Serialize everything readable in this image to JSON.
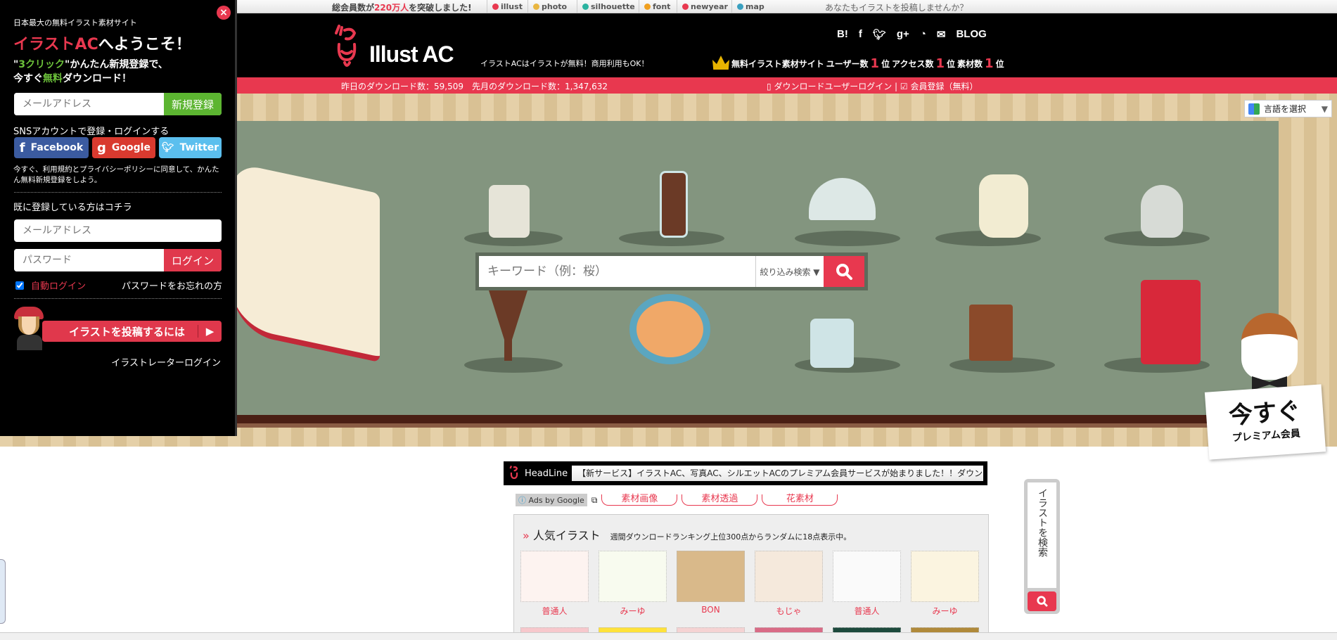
{
  "topbar": {
    "notice_prefix": "総会員数が",
    "notice_count": "220万人",
    "notice_suffix": "を突破しました!",
    "sites": [
      {
        "label": "illust",
        "color": "#e8384f"
      },
      {
        "label": "photo",
        "color": "#e9b640"
      },
      {
        "label": "silhouette",
        "color": "#2bb3a0"
      },
      {
        "label": "font",
        "color": "#f0a020"
      },
      {
        "label": "newyear",
        "color": "#e8384f"
      },
      {
        "label": "map",
        "color": "#3aa0c0"
      }
    ],
    "invite": "あなたもイラストを投稿しませんか？"
  },
  "header": {
    "logo": "Illust AC",
    "tagline": "イラストACはイラストが無料！商用利用もOK！",
    "social": [
      "B!",
      "f",
      "twitter-icon",
      "g+",
      "rss-icon",
      "mail-icon",
      "BLOG"
    ],
    "rank_prefix": "無料イラスト素材サイト",
    "ranks": [
      {
        "label": "ユーザー数",
        "value": "1",
        "unit": "位"
      },
      {
        "label": "アクセス数",
        "value": "1",
        "unit": "位"
      },
      {
        "label": "素材数",
        "value": "1",
        "unit": "位"
      }
    ]
  },
  "redbar": {
    "stats": "昨日のダウンロード数：59,509　先月のダウンロード数：1,347,632",
    "login_link": "ダウンロードユーザーログイン",
    "separator": "|",
    "register_link": "会員登録（無料）"
  },
  "banner": {
    "language_select": "言語を選択",
    "search_placeholder": "キーワード（例：桜）",
    "filter_label": "絞り込み検索 ▼",
    "sign_big": "今すぐ",
    "sign_small": "プレミアム会員"
  },
  "sidebar": {
    "subtitle": "日本最大の無料イラスト素材サイト",
    "welcome_red": "イラストAC",
    "welcome_rest": "へようこそ！",
    "line1_q1": "\"",
    "line1_green": "3クリック",
    "line1_rest": "\"かんたん新規登録で、",
    "line2_pre": "今すぐ",
    "line2_green": "無料",
    "line2_rest": "ダウンロード！",
    "email_placeholder": "メールアドレス",
    "register_button": "新規登録",
    "sns_label": "SNSアカウントで登録・ログインする",
    "facebook": "Facebook",
    "google": "Google",
    "twitter": "Twitter",
    "terms": "今すぐ、利用規約とプライバシーポリシーに同意して、かんたん無料新規登録をしよう。",
    "existing_label": "既に登録している方はコチラ",
    "login_email_placeholder": "メールアドレス",
    "password_placeholder": "パスワード",
    "login_button": "ログイン",
    "auto_login": "自動ログイン",
    "auto_login_checked": true,
    "forgot_password": "パスワードをお忘れの方",
    "post_button": "イラストを投稿するには",
    "illustrator_login": "イラストレーターログイン"
  },
  "headline": {
    "label": "HeadLine",
    "text": "【新サービス】イラストAC、写真AC、シルエットACのプレミアム会員サービスが始まりました！！ダウン"
  },
  "ads": {
    "label": "Ads by Google",
    "links": [
      "素材画像",
      "素材透過",
      "花素材"
    ]
  },
  "popular": {
    "title": "人気イラスト",
    "subtitle": "週間ダウンロードランキング上位300点からランダムに18点表示中。",
    "items": [
      {
        "author": "普通人"
      },
      {
        "author": "みーゆ"
      },
      {
        "author": "BON"
      },
      {
        "author": "もじゃ"
      },
      {
        "author": "普通人"
      },
      {
        "author": "みーゆ"
      }
    ]
  },
  "vertical_search": {
    "placeholder": "イラストを検索"
  },
  "colors": {
    "accent": "#e8384f",
    "green": "#5cb531",
    "board": "#83957f"
  }
}
